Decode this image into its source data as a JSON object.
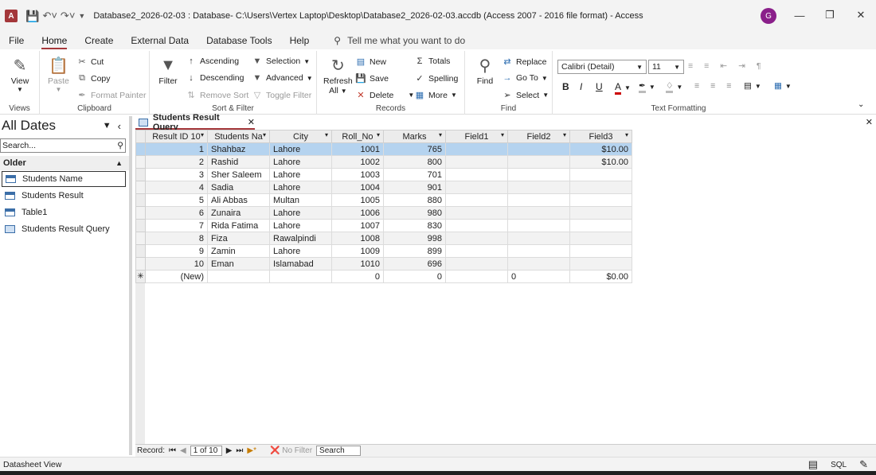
{
  "titlebar": {
    "app_icon": "A",
    "title": "Database2_2026-02-03 : Database- C:\\Users\\Vertex Laptop\\Desktop\\Database2_2026-02-03.accdb (Access 2007 - 2016 file format)  -  Access",
    "avatar": "G"
  },
  "menu": {
    "tabs": [
      "File",
      "Home",
      "Create",
      "External Data",
      "Database Tools",
      "Help"
    ],
    "active": "Home",
    "tell_me": "Tell me what you want to do"
  },
  "ribbon": {
    "views": {
      "view": "View",
      "label": "Views"
    },
    "clipboard": {
      "paste": "Paste",
      "cut": "Cut",
      "copy": "Copy",
      "format_painter": "Format Painter",
      "label": "Clipboard"
    },
    "sort_filter": {
      "filter": "Filter",
      "ascending": "Ascending",
      "descending": "Descending",
      "remove_sort": "Remove Sort",
      "selection": "Selection",
      "advanced": "Advanced",
      "toggle_filter": "Toggle Filter",
      "label": "Sort & Filter"
    },
    "records": {
      "refresh": "Refresh",
      "all": "All",
      "new": "New",
      "save": "Save",
      "delete": "Delete",
      "totals": "Totals",
      "spelling": "Spelling",
      "more": "More",
      "label": "Records"
    },
    "find": {
      "find": "Find",
      "replace": "Replace",
      "goto": "Go To",
      "select": "Select",
      "label": "Find"
    },
    "text_formatting": {
      "font": "Calibri (Detail)",
      "size": "11",
      "bold": "B",
      "italic": "I",
      "underline": "U",
      "label": "Text Formatting"
    }
  },
  "nav": {
    "title": "All Dates",
    "search_placeholder": "Search...",
    "group": "Older",
    "items": [
      {
        "label": "Students Name",
        "type": "table"
      },
      {
        "label": "Students Result",
        "type": "table"
      },
      {
        "label": "Table1",
        "type": "table"
      },
      {
        "label": "Students Result Query",
        "type": "query"
      }
    ]
  },
  "document": {
    "tab": "Students Result Query",
    "columns": [
      "Result ID 10",
      "Students Na",
      "City",
      "Roll_No",
      "Marks",
      "Field1",
      "Field2",
      "Field3"
    ],
    "rows": [
      [
        "1",
        "Shahbaz",
        "Lahore",
        "1001",
        "765",
        "",
        "",
        "$10.00"
      ],
      [
        "2",
        "Rashid",
        "Lahore",
        "1002",
        "800",
        "",
        "",
        "$10.00"
      ],
      [
        "3",
        "Sher Saleem",
        "Lahore",
        "1003",
        "701",
        "",
        "",
        ""
      ],
      [
        "4",
        "Sadia",
        "Lahore",
        "1004",
        "901",
        "",
        "",
        ""
      ],
      [
        "5",
        "Ali Abbas",
        "Multan",
        "1005",
        "880",
        "",
        "",
        ""
      ],
      [
        "6",
        "Zunaira",
        "Lahore",
        "1006",
        "980",
        "",
        "",
        ""
      ],
      [
        "7",
        "Rida Fatima",
        "Lahore",
        "1007",
        "830",
        "",
        "",
        ""
      ],
      [
        "8",
        "Fiza",
        "Rawalpindi",
        "1008",
        "998",
        "",
        "",
        ""
      ],
      [
        "9",
        "Zamin",
        "Lahore",
        "1009",
        "899",
        "",
        "",
        ""
      ],
      [
        "10",
        "Eman",
        "Islamabad",
        "1010",
        "696",
        "",
        "",
        ""
      ]
    ],
    "new_row": [
      "(New)",
      "",
      "",
      "0",
      "0",
      "",
      "0",
      "$0.00"
    ]
  },
  "record_nav": {
    "label": "Record:",
    "position": "1 of 10",
    "filter": "No Filter",
    "search": "Search"
  },
  "status": {
    "text": "Datasheet View",
    "sql": "SQL"
  }
}
